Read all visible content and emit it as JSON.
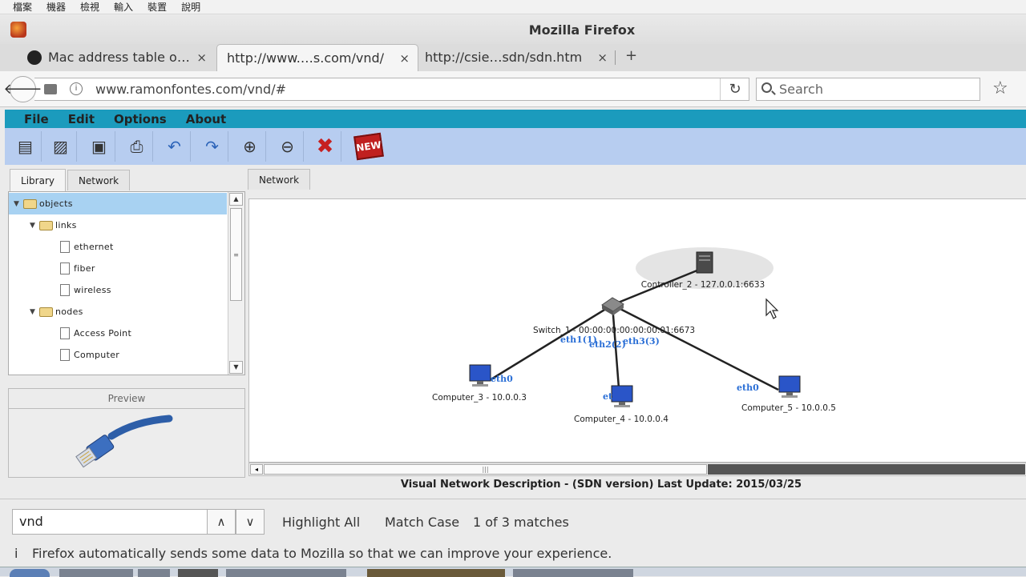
{
  "vm_menu": [
    "檔案",
    "機器",
    "檢視",
    "輸入",
    "裝置",
    "說明"
  ],
  "window": {
    "title": "Mozilla Firefox"
  },
  "tabs": [
    {
      "label": "Mac address table o…",
      "close": "×"
    },
    {
      "label": "http://www.…s.com/vnd/",
      "close": "×"
    },
    {
      "label": "http://csie…sdn/sdn.htm",
      "close": "×"
    }
  ],
  "new_tab": "+",
  "nav": {
    "back": "🡐",
    "info": "i",
    "url": "www.ramonfontes.com/vnd/#",
    "reload": "↻",
    "search_placeholder": "Search",
    "bookmark": "☆"
  },
  "app": {
    "menu": [
      "File",
      "Edit",
      "Options",
      "About"
    ],
    "toolbar_icons": [
      "new-icon",
      "open-icon",
      "save-icon",
      "print-icon",
      "undo-icon",
      "redo-icon",
      "zoom-in-icon",
      "zoom-out-icon",
      "delete-icon",
      "new-badge-icon"
    ],
    "new_badge": "NEW",
    "panel_tabs": [
      "Library",
      "Network"
    ],
    "tree": [
      {
        "label": "objects",
        "type": "folder",
        "level": 0,
        "expanded": true,
        "selected": true
      },
      {
        "label": "links",
        "type": "folder",
        "level": 1,
        "expanded": true
      },
      {
        "label": "ethernet",
        "type": "file",
        "level": 2
      },
      {
        "label": "fiber",
        "type": "file",
        "level": 2
      },
      {
        "label": "wireless",
        "type": "file",
        "level": 2
      },
      {
        "label": "nodes",
        "type": "folder",
        "level": 1,
        "expanded": true
      },
      {
        "label": "Access Point",
        "type": "file",
        "level": 2
      },
      {
        "label": "Computer",
        "type": "file",
        "level": 2
      }
    ],
    "preview_label": "Preview",
    "network_tab": "Network",
    "topology": {
      "controller": "Controller_2 - 127.0.0.1:6633",
      "switch": "Switch_1 - 00:00:00:00:00:00:01:6673",
      "computers": [
        "Computer_3 - 10.0.0.3",
        "Computer_4 - 10.0.0.4",
        "Computer_5 - 10.0.0.5"
      ],
      "ports": [
        "eth1(1)",
        "eth2(2)",
        "eth3(3)"
      ],
      "host_ifaces": [
        "eth0",
        "et",
        "eth0"
      ]
    },
    "footer": "Visual Network Description - (SDN version)   Last Update: 2015/03/25"
  },
  "findbar": {
    "query": "vnd",
    "prev": "∧",
    "next": "∨",
    "highlight_all": "Highlight All",
    "match_case": "Match Case",
    "status": "1 of 3 matches"
  },
  "notification": {
    "icon": "i",
    "message": "Firefox automatically sends some data to Mozilla so that we can improve your experience."
  }
}
